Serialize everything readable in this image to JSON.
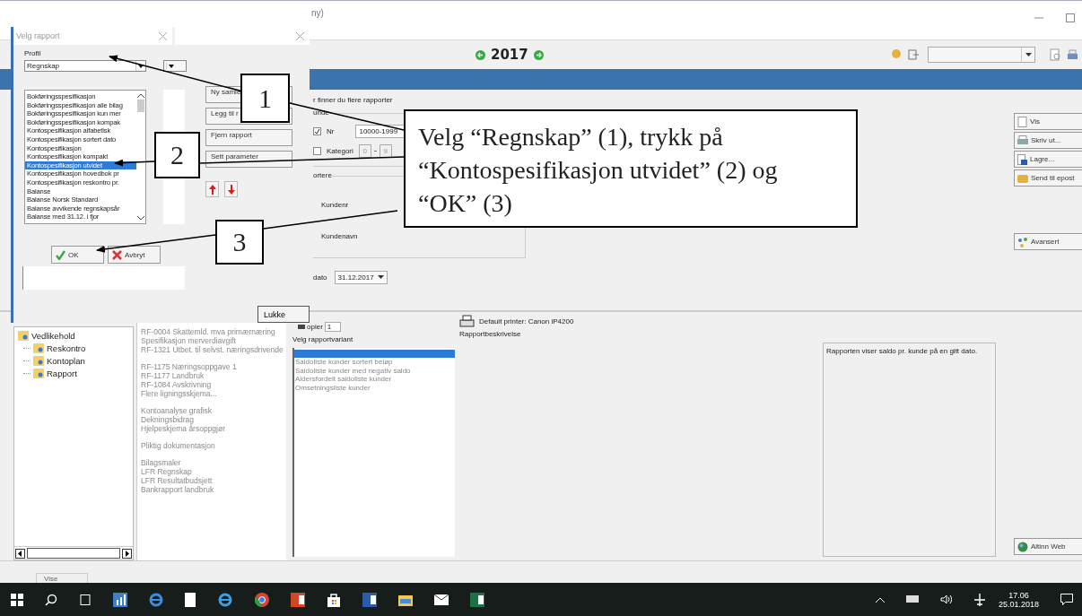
{
  "window": {
    "title": "ny)"
  },
  "year": "2017",
  "banner_text": "r finner du flere rapporter",
  "customer_group": {
    "legend": "unde",
    "nr_label": "Nr",
    "nr_checked": true,
    "nr_value": "10000-1999",
    "category_label": "Kategori",
    "category_checked": false,
    "category_from": "0",
    "category_to": "9"
  },
  "sort_group": {
    "legend": "ortere",
    "options": [
      "Kundenr",
      "Kundenavn"
    ]
  },
  "date": {
    "label": "dato",
    "value": "31.12.2017"
  },
  "side_buttons": [
    {
      "kind": "view",
      "label": "Vis"
    },
    {
      "kind": "print",
      "label": "Skriv ut..."
    },
    {
      "kind": "save",
      "label": "Lagre..."
    },
    {
      "kind": "mail",
      "label": "Send til epost"
    },
    {
      "kind": "advanced",
      "label": "Avansert"
    }
  ],
  "web_button": {
    "label": "Altinn Web"
  },
  "tree": [
    {
      "label": "Vedlikehold",
      "children": [
        {
          "label": "Reskontro"
        },
        {
          "label": "Kontoplan"
        },
        {
          "label": "Rapport"
        }
      ]
    }
  ],
  "report_groups": [
    [
      "RF-0004 Skattemld. mva primærnæring",
      "Spesifikasjon merverdiavgift",
      "RF-1321 Utbet. til selvst. næringsdrivende"
    ],
    [
      "RF-1175 Næringsoppgave 1",
      "RF-1177 Landbruk",
      "RF-1084 Avskrivning",
      "Flere ligningsskjema..."
    ],
    [
      "Kontoanalyse grafisk",
      "Dekningsbidrag",
      "Hjelpeskjema årsoppgjør"
    ],
    [
      "Pliktig dokumentasjon"
    ],
    [
      "Bilagsmaler",
      "LFR Regnskap",
      "LFR Resultatbudsjett",
      "Bankrapport landbruk"
    ]
  ],
  "copies": {
    "label": "opier",
    "value": "1"
  },
  "variant_title": "Velg rapportvariant",
  "variants": [
    {
      "selected": true
    },
    {
      "label": "Saldoliste kunder sortert beløp",
      "selected": false
    },
    {
      "label": "Saldoliste kunder med negativ saldo",
      "selected": false
    },
    {
      "label": "Aldersfordelt saldoliste kunder",
      "selected": false
    },
    {
      "label": "Omsetningsliste kunder",
      "selected": false
    }
  ],
  "printer": "Default printer: Canon iP4200",
  "description_title": "Rapportbeskrivelse",
  "description": "Rapporten viser saldo pr. kunde på en gitt dato.",
  "status_bar": {
    "text": "Vise"
  },
  "dialog": {
    "title": "Velg rapport",
    "profile_label": "Profil",
    "profile_value": "Regnskap",
    "reports": [
      {
        "label": "Bokføringsspesifikasjon",
        "selected": false
      },
      {
        "label": "Bokføringsspesifikasjon alle bilag",
        "selected": false
      },
      {
        "label": "Bokføringsspesifikasjon kun mer",
        "selected": false
      },
      {
        "label": "Bokføringsspesifikasjon kompak",
        "selected": false
      },
      {
        "label": "Kontospesifikasjon alfabetisk",
        "selected": false
      },
      {
        "label": "Kontospesifikasjon sortert dato",
        "selected": false
      },
      {
        "label": "Kontospesifikasjon",
        "selected": false
      },
      {
        "label": "Kontospesifikasjon kompakt",
        "selected": false
      },
      {
        "label": "Kontospesifikasjon utvidet",
        "selected": true
      },
      {
        "label": "Kontospesifikasjon hovedbok pr",
        "selected": false
      },
      {
        "label": "Kontospesifikasjon reskontro pr.",
        "selected": false
      },
      {
        "label": "Balanse",
        "selected": false
      },
      {
        "label": "Balanse Norsk Standard",
        "selected": false
      },
      {
        "label": "Balanse avvikende regnskapsår",
        "selected": false
      },
      {
        "label": "Balanse med 31.12. i fjor",
        "selected": false
      }
    ],
    "buttons": [
      "Ny samle",
      "Legg til r",
      "Fjern rapport",
      "Sett parameter"
    ],
    "ok": "OK",
    "cancel": "Avbryt",
    "close": "Lukke"
  },
  "callouts": [
    "1",
    "2",
    "3"
  ],
  "instruction": "Velg “Regnskap” (1), trykk på “Kontospesifikasjon utvidet” (2) og “OK” (3)",
  "clock": {
    "time": "17.06",
    "date": "25.01.2018"
  }
}
